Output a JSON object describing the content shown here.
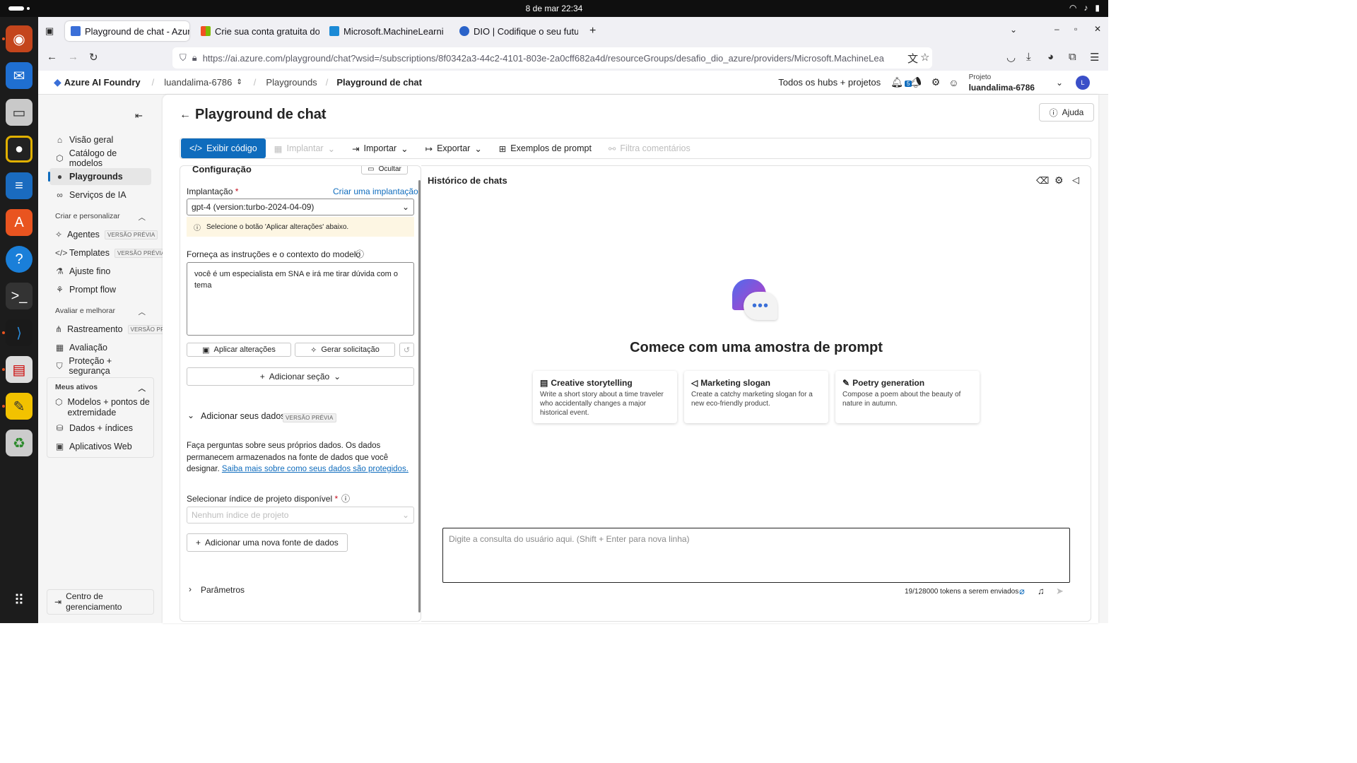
{
  "os": {
    "clock": "8 de mar  22:34"
  },
  "browser": {
    "tabs": [
      {
        "title": "Playground de chat - Azur",
        "active": true
      },
      {
        "title": "Crie sua conta gratuita do",
        "active": false
      },
      {
        "title": "Microsoft.MachineLearni",
        "active": false
      },
      {
        "title": "DIO | Codifique o seu futu",
        "active": false
      }
    ],
    "url": "https://ai.azure.com/playground/chat?wsid=/subscriptions/8f0342a3-44c2-4101-803e-2a0cff682a4d/resourceGroups/desafio_dio_azure/providers/Microsoft.MachineLea"
  },
  "header": {
    "brand": "Azure AI Foundry",
    "hub": "luandalima-6786",
    "crumb1": "Playgrounds",
    "crumb2": "Playground de chat",
    "all_hubs": "Todos os hubs + projetos",
    "notif_count": "5",
    "project_label": "Projeto",
    "project_name": "luandalima-6786",
    "avatar": "L"
  },
  "sidebar": {
    "items": [
      {
        "label": "Visão geral",
        "icon": "home-icon"
      },
      {
        "label": "Catálogo de modelos",
        "icon": "cube-icon"
      },
      {
        "label": "Playgrounds",
        "icon": "chat-icon"
      },
      {
        "label": "Serviços de IA",
        "icon": "link-icon"
      }
    ],
    "section1": "Criar e personalizar",
    "section1_items": [
      {
        "label": "Agentes",
        "badge": "VERSÃO PRÉVIA"
      },
      {
        "label": "Templates",
        "badge": "VERSÃO PRÉVIA"
      },
      {
        "label": "Ajuste fino"
      },
      {
        "label": "Prompt flow"
      }
    ],
    "section2": "Avaliar e melhorar",
    "section2_items": [
      {
        "label": "Rastreamento",
        "badge": "VERSÃO PRÉ"
      },
      {
        "label": "Avaliação"
      },
      {
        "label": "Proteção + segurança"
      }
    ],
    "section3": "Meus ativos",
    "section3_items": [
      {
        "label": "Modelos + pontos de extremidade"
      },
      {
        "label": "Dados + índices"
      },
      {
        "label": "Aplicativos Web"
      }
    ],
    "footer": "Centro de gerenciamento"
  },
  "main": {
    "title": "Playground de chat",
    "help": "Ajuda",
    "toolbar": {
      "code": "Exibir código",
      "deploy": "Implantar",
      "import": "Importar",
      "export": "Exportar",
      "examples": "Exemplos de prompt",
      "feedback": "Filtra comentários"
    },
    "config": {
      "title": "Configuração",
      "hide": "Ocultar",
      "deployment_label": "Implantação",
      "create_deployment": "Criar uma implantação",
      "deployment_value": "gpt-4 (version:turbo-2024-04-09)",
      "warning": "Selecione o botão 'Aplicar alterações' abaixo.",
      "instructions_label": "Forneça as instruções e o contexto do modelo",
      "instructions_value": "você é um especialista em SNA e irá me tirar dúvida com o tema",
      "apply": "Aplicar alterações",
      "generate": "Gerar solicitação",
      "add_section": "Adicionar seção",
      "add_data": "Adicionar seus dados",
      "add_data_badge": "VERSÃO PRÉVIA",
      "data_text": "Faça perguntas sobre seus próprios dados. Os dados permanecem armazenados na fonte de dados que você designar.",
      "data_link": "Saiba mais sobre como seus dados são protegidos.",
      "index_label": "Selecionar índice de projeto disponível",
      "index_placeholder": "Nenhum índice de projeto",
      "add_source": "Adicionar uma nova fonte de dados",
      "params": "Parâmetros"
    },
    "chat": {
      "title": "Histórico de chats",
      "start_title": "Comece com uma amostra de prompt",
      "cards": [
        {
          "title": "Creative storytelling",
          "desc": "Write a short story about a time traveler who accidentally changes a major historical event."
        },
        {
          "title": "Marketing slogan",
          "desc": "Create a catchy marketing slogan for a new eco-friendly product."
        },
        {
          "title": "Poetry generation",
          "desc": "Compose a poem about the beauty of nature in autumn."
        }
      ],
      "input_placeholder": "Digite a consulta do usuário aqui. (Shift + Enter para nova linha)",
      "tokens": "19/128000 tokens a serem enviados"
    }
  },
  "colors": {
    "accent": "#0f6cbd",
    "warning_bg": "#fdf6e3"
  }
}
